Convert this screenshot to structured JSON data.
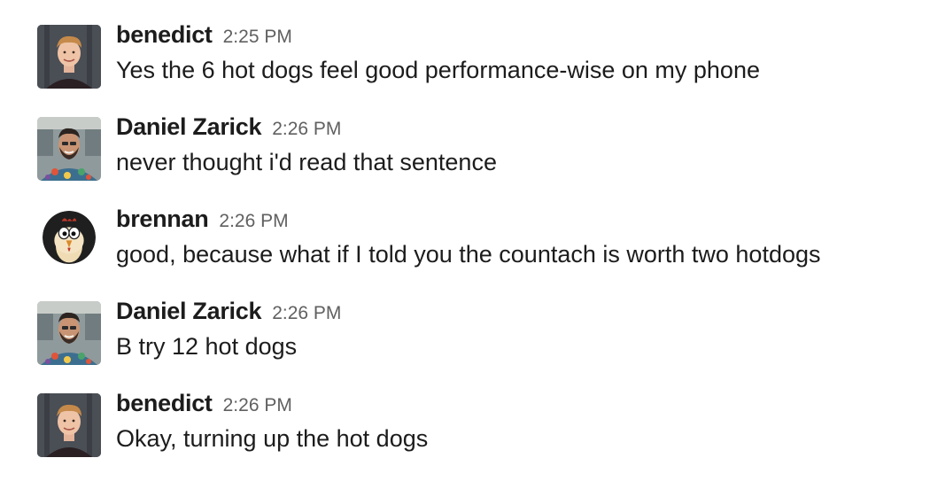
{
  "messages": [
    {
      "author": "benedict",
      "time": "2:25 PM",
      "text": "Yes the 6 hot dogs feel good performance-wise on my phone",
      "avatar": "benedict-avatar"
    },
    {
      "author": "Daniel Zarick",
      "time": "2:26 PM",
      "text": "never thought i'd read that sentence",
      "avatar": "daniel-avatar"
    },
    {
      "author": "brennan",
      "time": "2:26 PM",
      "text": "good, because what if I told you the countach is worth two hotdogs",
      "avatar": "brennan-avatar"
    },
    {
      "author": "Daniel Zarick",
      "time": "2:26 PM",
      "text": "B try 12 hot dogs",
      "avatar": "daniel-avatar"
    },
    {
      "author": "benedict",
      "time": "2:26 PM",
      "text": "Okay, turning up the hot dogs",
      "avatar": "benedict-avatar"
    }
  ],
  "colors": {
    "text": "#1d1c1d",
    "timestamp": "#616061",
    "background": "#ffffff"
  }
}
